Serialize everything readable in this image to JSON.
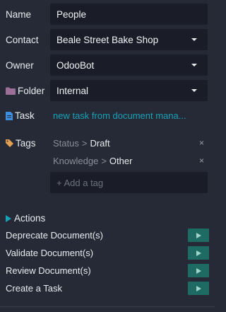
{
  "fields": {
    "name": {
      "label": "Name",
      "value": "People"
    },
    "contact": {
      "label": "Contact",
      "value": "Beale Street Bake Shop"
    },
    "owner": {
      "label": "Owner",
      "value": "OdooBot"
    },
    "folder": {
      "label": "Folder",
      "value": "Internal",
      "icon": "folder-icon",
      "icon_color": "#9b6f97"
    },
    "task": {
      "label": "Task",
      "value": "new task from document mana...",
      "icon": "document-icon",
      "icon_color": "#3c8ee0"
    }
  },
  "tags": {
    "label": "Tags",
    "icon": "tag-icon",
    "icon_color": "#e0a251",
    "items": [
      {
        "category": "Status",
        "separator": ">",
        "value": "Draft",
        "remove": "×"
      },
      {
        "category": "Knowledge",
        "separator": ">",
        "value": "Other",
        "remove": "×"
      }
    ],
    "add_placeholder": "+ Add a tag"
  },
  "actions": {
    "title": "Actions",
    "items": [
      {
        "label": "Deprecate Document(s)"
      },
      {
        "label": "Validate Document(s)"
      },
      {
        "label": "Review Document(s)"
      },
      {
        "label": "Create a Task"
      }
    ]
  },
  "colors": {
    "background": "#262a36",
    "field_background": "#1a1d27",
    "link": "#17a2b8",
    "action_button": "#1e6b64"
  }
}
